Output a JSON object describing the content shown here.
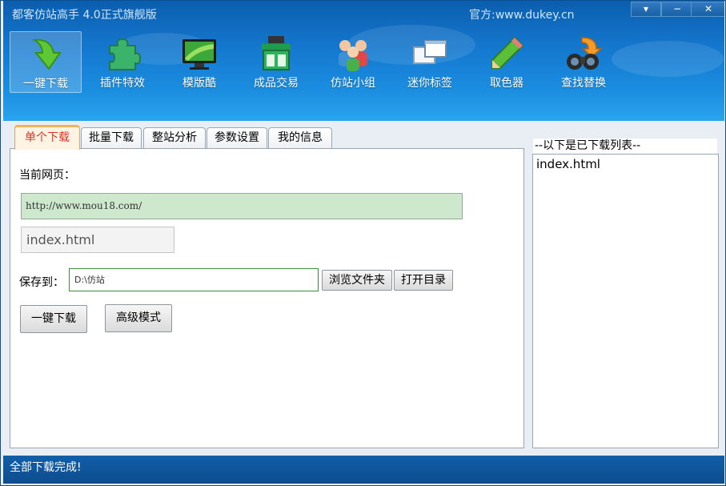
{
  "window": {
    "title": "都客仿站高手 4.0正式旗舰版",
    "site": "官方:www.dukey.cn",
    "controls": {
      "menu": "▾",
      "minimize": "−",
      "close": "✕"
    }
  },
  "toolbar": [
    {
      "label": "一键下载",
      "icon": "download-arrow-icon",
      "active": true
    },
    {
      "label": "插件特效",
      "icon": "puzzle-icon"
    },
    {
      "label": "模版酷",
      "icon": "monitor-icon"
    },
    {
      "label": "成品交易",
      "icon": "shop-icon"
    },
    {
      "label": "仿站小组",
      "icon": "group-icon"
    },
    {
      "label": "迷你标签",
      "icon": "windows-icon"
    },
    {
      "label": "取色器",
      "icon": "pencil-icon"
    },
    {
      "label": "查找替换",
      "icon": "binoculars-icon"
    }
  ],
  "tabs": [
    {
      "label": "单个下载",
      "active": true
    },
    {
      "label": "批量下载"
    },
    {
      "label": "整站分析"
    },
    {
      "label": "参数设置"
    },
    {
      "label": "我的信息"
    }
  ],
  "form": {
    "current_page_label": "当前网页：",
    "url_value": "http://www.mou18.com/",
    "file_value": "index.html",
    "save_label": "保存到：",
    "save_path": "D:\\仿站",
    "browse_label": "浏览文件夹",
    "open_dir_label": "打开目录",
    "download_label": "一键下载",
    "advanced_label": "高级模式"
  },
  "downloaded": {
    "caption": "--以下是已下载列表--",
    "items": [
      "index.html"
    ]
  },
  "status": "全部下载完成!",
  "colors": {
    "header": "#1478cf",
    "status_bar": "#0d4d8e",
    "active_tab_text": "#d8342a",
    "url_field_bg": "#cde8cd"
  }
}
